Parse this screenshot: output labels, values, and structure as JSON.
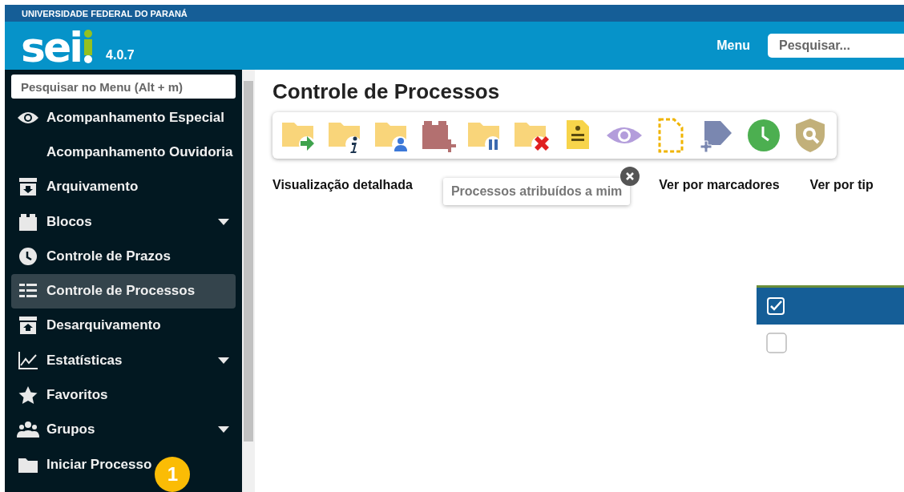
{
  "header": {
    "institution": "UNIVERSIDADE FEDERAL DO PARANÁ",
    "logo_text": "sei",
    "version": "4.0.7",
    "menu_label": "Menu",
    "search": {
      "placeholder": "Pesquisar..."
    }
  },
  "sidebar": {
    "search": {
      "placeholder": "Pesquisar no Menu (Alt + m)"
    },
    "items": [
      {
        "label": "Acompanhamento Especial",
        "has_submenu": false,
        "selected": false
      },
      {
        "label": "Acompanhamento Ouvidoria",
        "has_submenu": false,
        "selected": false
      },
      {
        "label": "Arquivamento",
        "has_submenu": false,
        "selected": false
      },
      {
        "label": "Blocos",
        "has_submenu": true,
        "selected": false
      },
      {
        "label": "Controle de Prazos",
        "has_submenu": false,
        "selected": false
      },
      {
        "label": "Controle de Processos",
        "has_submenu": false,
        "selected": true
      },
      {
        "label": "Desarquivamento",
        "has_submenu": false,
        "selected": false
      },
      {
        "label": "Estatísticas",
        "has_submenu": true,
        "selected": false
      },
      {
        "label": "Favoritos",
        "has_submenu": false,
        "selected": false
      },
      {
        "label": "Grupos",
        "has_submenu": true,
        "selected": false
      },
      {
        "label": "Iniciar Processo",
        "has_submenu": false,
        "selected": false,
        "badge": "1"
      }
    ]
  },
  "main": {
    "title": "Controle de Processos",
    "view_links": [
      {
        "label": "Visualização detalhada"
      },
      {
        "label": "Ver por marcadores"
      },
      {
        "label": "Ver por tip"
      }
    ],
    "tooltip": {
      "text": "Processos atribuídos a mim"
    },
    "table": {
      "header_checkbox": {
        "checked": true
      },
      "rows": [
        {
          "checked": false
        }
      ]
    }
  }
}
